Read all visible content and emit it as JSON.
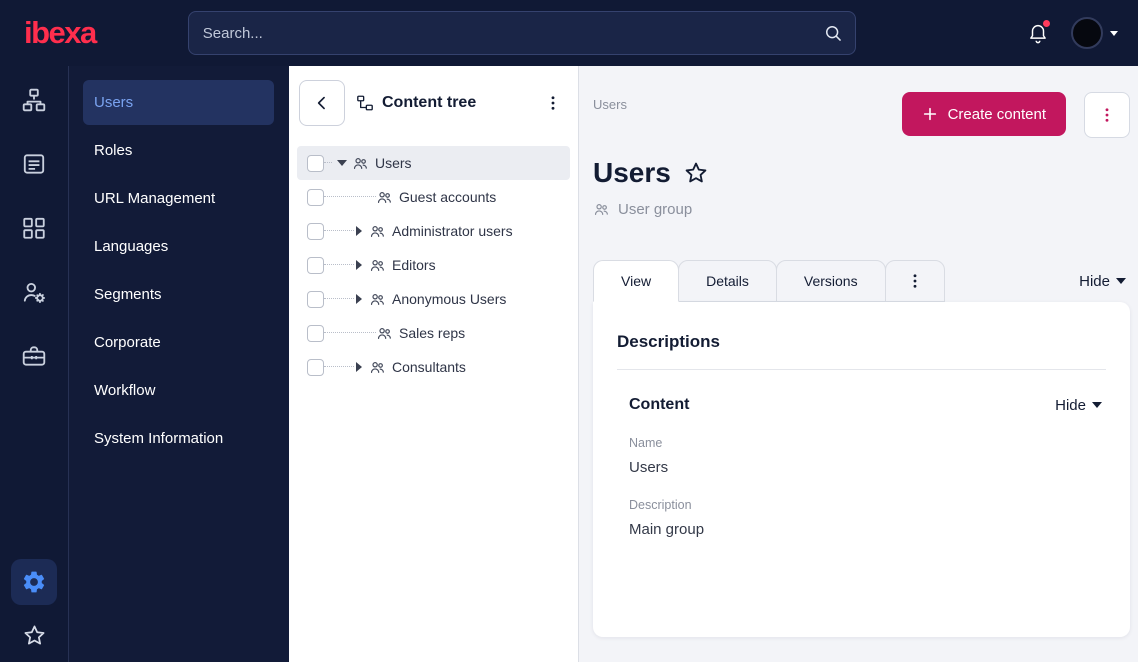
{
  "topbar": {
    "logo_text": "ibexa",
    "search_placeholder": "Search...",
    "icons": [
      "search-icon",
      "bell-icon",
      "avatar",
      "chevron-down-icon"
    ]
  },
  "rail": {
    "items": [
      {
        "icon": "sitemap-icon"
      },
      {
        "icon": "content-list-icon"
      },
      {
        "icon": "modules-icon"
      },
      {
        "icon": "person-gear-icon"
      },
      {
        "icon": "toolbox-icon"
      }
    ],
    "bottom": [
      {
        "icon": "gear-icon",
        "active": true
      },
      {
        "icon": "star-icon"
      }
    ]
  },
  "sidebar": {
    "items": [
      {
        "label": "Users",
        "active": true
      },
      {
        "label": "Roles",
        "active": false
      },
      {
        "label": "URL Management",
        "active": false
      },
      {
        "label": "Languages",
        "active": false
      },
      {
        "label": "Segments",
        "active": false
      },
      {
        "label": "Corporate",
        "active": false
      },
      {
        "label": "Workflow",
        "active": false
      },
      {
        "label": "System Information",
        "active": false
      }
    ]
  },
  "content_tree": {
    "title": "Content tree",
    "items": [
      {
        "label": "Users",
        "level": 0,
        "caret": "down",
        "selected": true,
        "checked": false,
        "icon": "user-group-icon"
      },
      {
        "label": "Guest accounts",
        "level": 1,
        "caret": "none",
        "selected": false,
        "checked": false,
        "icon": "user-group-icon"
      },
      {
        "label": "Administrator users",
        "level": 1,
        "caret": "right",
        "selected": false,
        "checked": false,
        "icon": "user-group-icon"
      },
      {
        "label": "Editors",
        "level": 1,
        "caret": "right",
        "selected": false,
        "checked": false,
        "icon": "user-group-icon"
      },
      {
        "label": "Anonymous Users",
        "level": 1,
        "caret": "right",
        "selected": false,
        "checked": false,
        "icon": "user-group-icon"
      },
      {
        "label": "Sales reps",
        "level": 1,
        "caret": "none",
        "selected": false,
        "checked": false,
        "icon": "user-group-icon"
      },
      {
        "label": "Consultants",
        "level": 1,
        "caret": "right",
        "selected": false,
        "checked": false,
        "icon": "user-group-icon"
      }
    ]
  },
  "main": {
    "breadcrumb": "Users",
    "create_button_label": "Create content",
    "title": "Users",
    "content_type_label": "User group",
    "tabs": [
      {
        "label": "View",
        "active": true
      },
      {
        "label": "Details",
        "active": false
      },
      {
        "label": "Versions",
        "active": false
      }
    ],
    "hide_label": "Hide",
    "card": {
      "heading": "Descriptions",
      "section_title": "Content",
      "section_hide_label": "Hide",
      "fields": [
        {
          "label": "Name",
          "value": "Users"
        },
        {
          "label": "Description",
          "value": "Main group"
        }
      ]
    }
  },
  "colors": {
    "topbar_bg": "#101935",
    "brand_red": "#ff2e4d",
    "primary_button": "#c2175e",
    "active_sidebar_text": "#7aa3f0",
    "active_sidebar_bg": "#233361",
    "main_bg": "#f3f4f8"
  }
}
